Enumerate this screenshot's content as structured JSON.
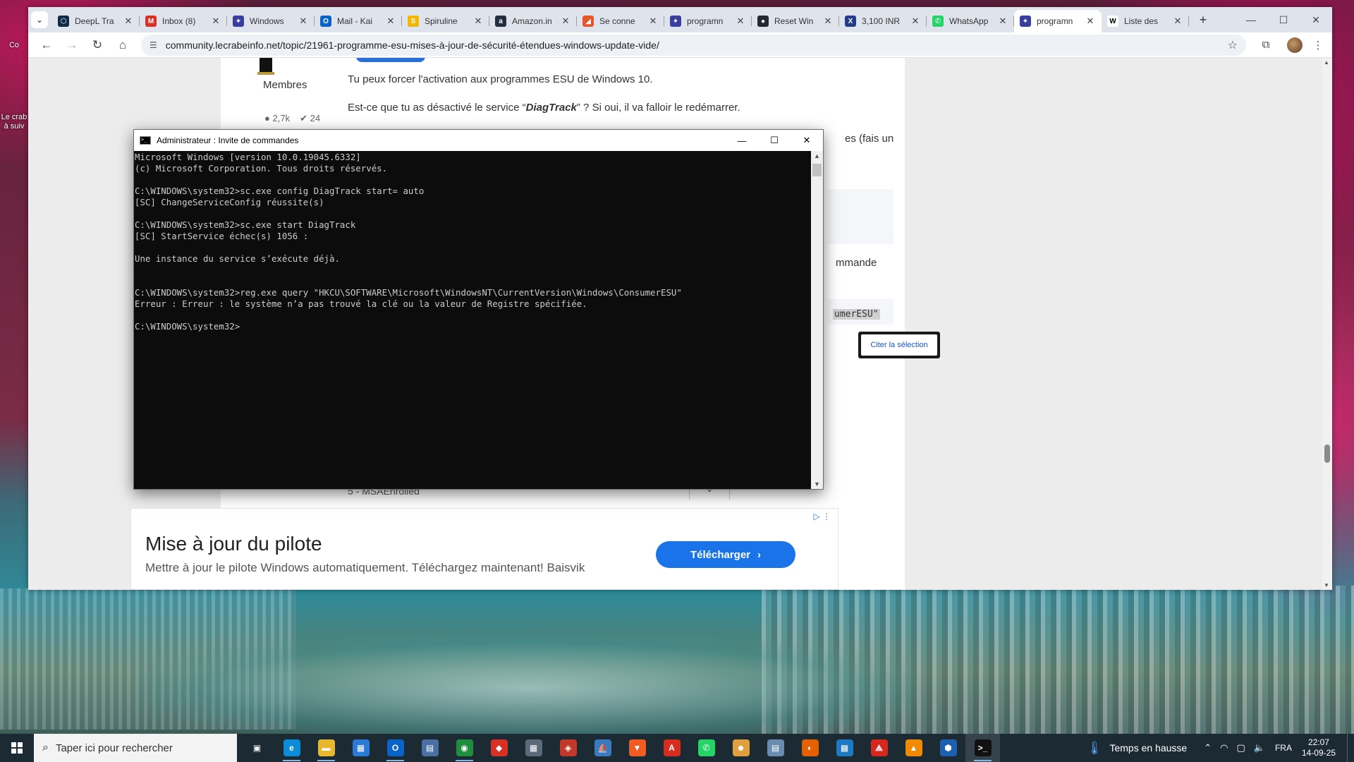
{
  "desktop": {
    "icon_label_1": "Co",
    "icon_label_2": "Le crab à suiv"
  },
  "browser": {
    "tabs": [
      {
        "label": "DeepL Tra",
        "color": "#0f2b46",
        "glyph": "⬡"
      },
      {
        "label": "Inbox (8)",
        "color": "#d93025",
        "glyph": "M"
      },
      {
        "label": "Windows",
        "color": "#3b3f9c",
        "glyph": "✦"
      },
      {
        "label": "Mail - Kai",
        "color": "#0a64c8",
        "glyph": "O"
      },
      {
        "label": "Spiruline",
        "color": "#f2b500",
        "glyph": "S"
      },
      {
        "label": "Amazon.in",
        "color": "#232f3e",
        "glyph": "a"
      },
      {
        "label": "Se conne",
        "color": "#e8552d",
        "glyph": "◢"
      },
      {
        "label": "programn",
        "color": "#3b3f9c",
        "glyph": "✦"
      },
      {
        "label": "Reset Win",
        "color": "#24292f",
        "glyph": "●"
      },
      {
        "label": "3,100 INR",
        "color": "#233c8c",
        "glyph": "X"
      },
      {
        "label": "WhatsApp",
        "color": "#25d366",
        "glyph": "✆"
      },
      {
        "label": "programn",
        "color": "#3b3f9c",
        "glyph": "✦",
        "active": true
      },
      {
        "label": "Liste des",
        "color": "#ffffff",
        "glyph": "W"
      }
    ],
    "url": "community.lecrabeinfo.net/topic/21961-programme-esu-mises-à-jour-de-sécurité-étendues-windows-update-vide/"
  },
  "page": {
    "members_label": "Membres",
    "stats_posts": "2,7k",
    "stats_rep": "24",
    "p1": "Tu peux forcer l'activation aux programmes ESU de Windows 10.",
    "p2_before": "Est-ce que tu as désactivé le service “",
    "p2_bold": "DiagTrack",
    "p2_after": "” ? Si oui, il va falloir le redémarrer.",
    "frag1": "es (fais un",
    "frag2": "mmande",
    "code_frag": "umerESU\"",
    "quote_button": "Citer la sélection",
    "select_frag": "5 - MSAEnrolled"
  },
  "ad": {
    "title": "Mise à jour du pilote",
    "subtitle": "Mettre à jour le pilote Windows automatiquement. Téléchargez maintenant! Baisvik",
    "button": "Télécharger"
  },
  "cmd": {
    "title": "Administrateur : Invite de commandes",
    "output": "Microsoft Windows [version 10.0.19045.6332]\n(c) Microsoft Corporation. Tous droits réservés.\n\nC:\\WINDOWS\\system32>sc.exe config DiagTrack start= auto\n[SC] ChangeServiceConfig réussite(s)\n\nC:\\WINDOWS\\system32>sc.exe start DiagTrack\n[SC] StartService échec(s) 1056 :\n\nUne instance du service s’exécute déjà.\n\n\nC:\\WINDOWS\\system32>reg.exe query \"HKCU\\SOFTWARE\\Microsoft\\WindowsNT\\CurrentVersion\\Windows\\ConsumerESU\"\nErreur : Erreur : le système n’a pas trouvé la clé ou la valeur de Registre spécifiée.\n\nC:\\WINDOWS\\system32>"
  },
  "taskbar": {
    "search_placeholder": "Taper ici pour rechercher",
    "apps": [
      {
        "name": "task-view",
        "color": "#1c2a33",
        "glyph": "▣"
      },
      {
        "name": "edge",
        "color": "#0c8bd6",
        "glyph": "e"
      },
      {
        "name": "file-explorer",
        "color": "#e8b730",
        "glyph": "▬"
      },
      {
        "name": "store",
        "color": "#2a7ad6",
        "glyph": "▦"
      },
      {
        "name": "outlook",
        "color": "#0a64c8",
        "glyph": "O"
      },
      {
        "name": "network",
        "color": "#4a6fa5",
        "glyph": "▤"
      },
      {
        "name": "chrome",
        "color": "#1e8e3e",
        "glyph": "◉"
      },
      {
        "name": "anydesk",
        "color": "#d93025",
        "glyph": "◆"
      },
      {
        "name": "calculator",
        "color": "#5a6a78",
        "glyph": "▦"
      },
      {
        "name": "app-red",
        "color": "#c0392b",
        "glyph": "◈"
      },
      {
        "name": "ship-app",
        "color": "#3a7bbf",
        "glyph": "⛵"
      },
      {
        "name": "brave",
        "color": "#f25c23",
        "glyph": "▼"
      },
      {
        "name": "foxit",
        "color": "#d62d20",
        "glyph": "A"
      },
      {
        "name": "whatsapp",
        "color": "#25d366",
        "glyph": "✆"
      },
      {
        "name": "cat-app",
        "color": "#e0a040",
        "glyph": "☻"
      },
      {
        "name": "notepad",
        "color": "#6a8cb0",
        "glyph": "▤"
      },
      {
        "name": "firefox",
        "color": "#e66000",
        "glyph": "◐"
      },
      {
        "name": "remote-desktop",
        "color": "#1d7ac2",
        "glyph": "▩"
      },
      {
        "name": "acrobat",
        "color": "#d6281e",
        "glyph": "⟁"
      },
      {
        "name": "vlc",
        "color": "#f08a00",
        "glyph": "▲"
      },
      {
        "name": "vpn",
        "color": "#1d5fb0",
        "glyph": "⬢"
      },
      {
        "name": "cmd",
        "color": "#111111",
        "glyph": ">_"
      }
    ],
    "weather": "Temps en hausse",
    "lang": "FRA",
    "time": "22:07",
    "date": "14-09-25"
  }
}
